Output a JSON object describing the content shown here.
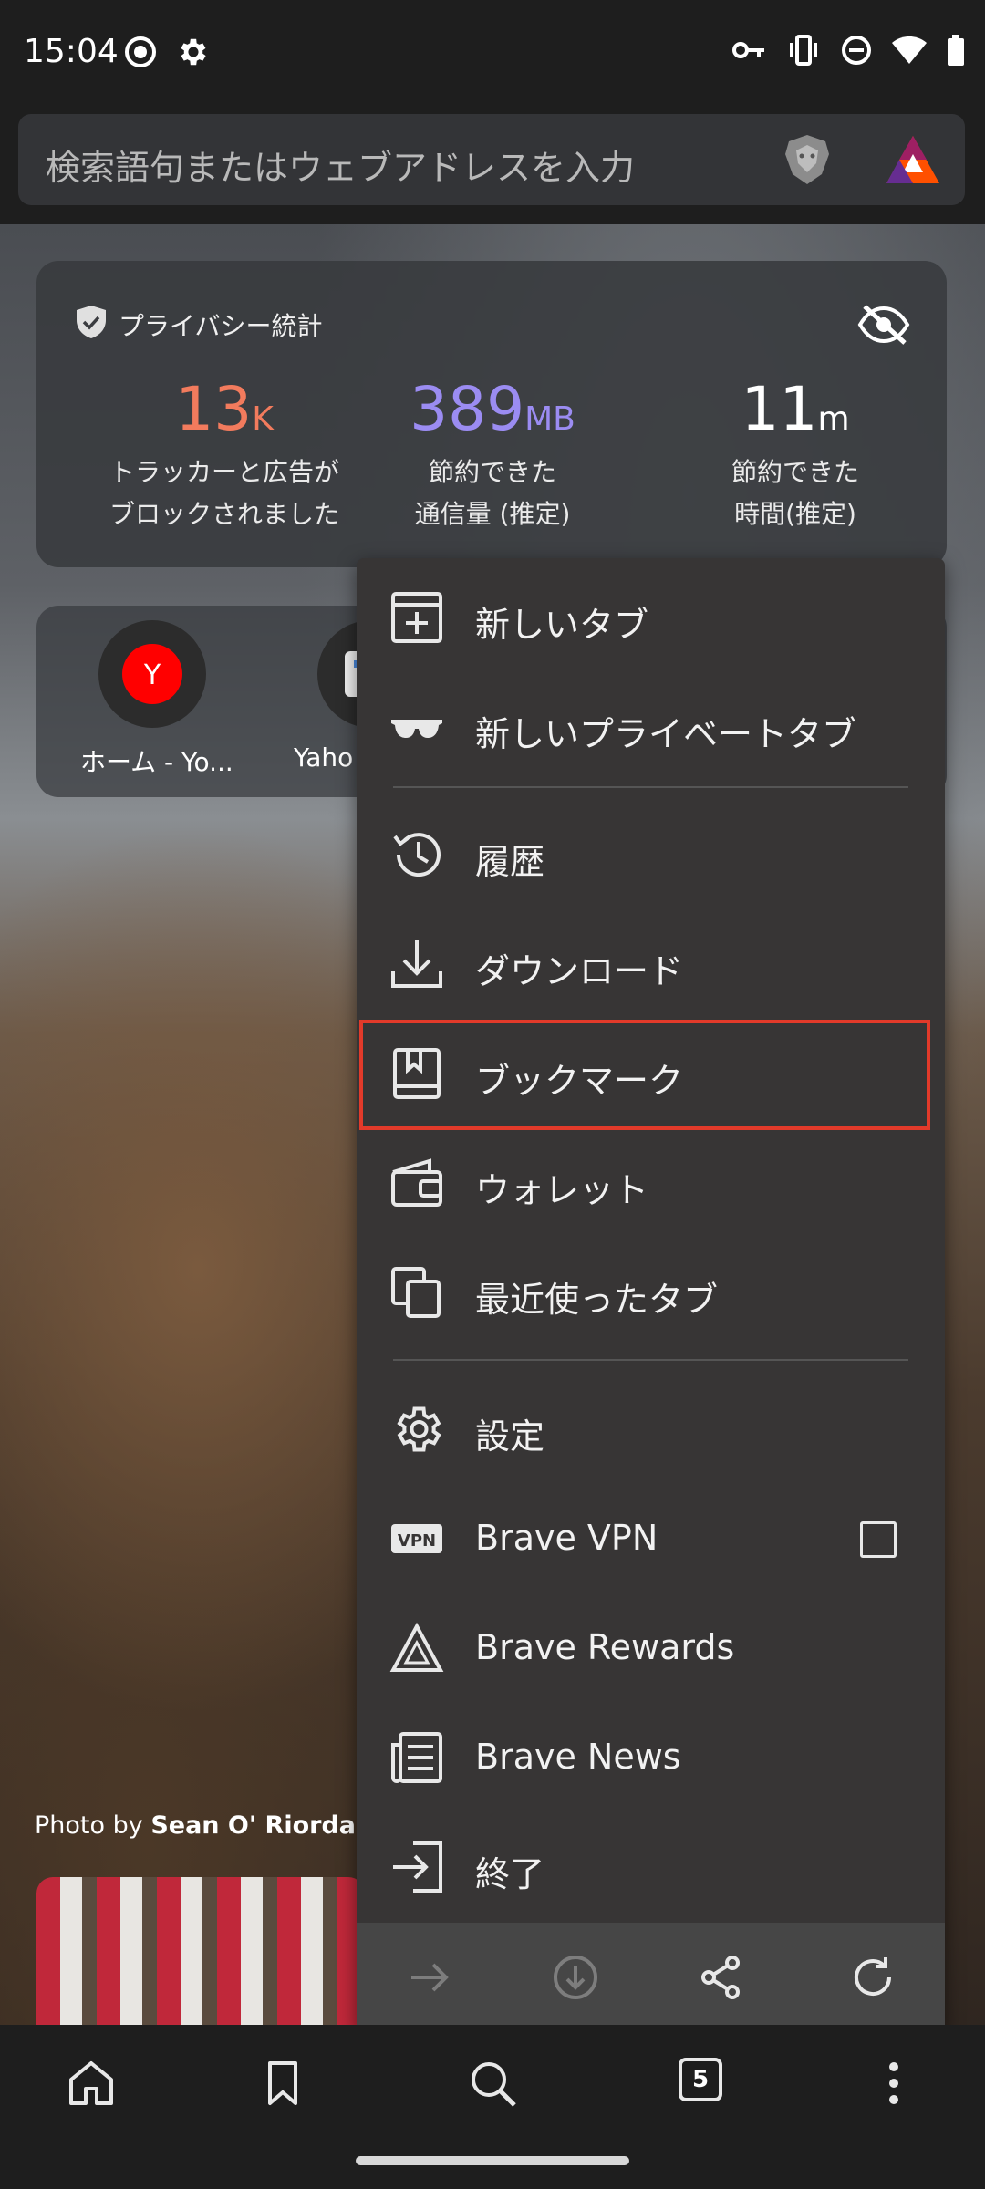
{
  "status_bar": {
    "time": "15:04"
  },
  "address_bar": {
    "placeholder": "検索語句またはウェブアドレスを入力"
  },
  "privacy_stats": {
    "title": "プライバシー統計",
    "trackers": {
      "value": "13",
      "unit": "K",
      "label_line1": "トラッカーと広告が",
      "label_line2": "ブロックされました",
      "color": "#f27b5d"
    },
    "bandwidth": {
      "value": "389",
      "unit": "MB",
      "label_line1": "節約できた",
      "label_line2": "通信量 (推定)",
      "color": "#9b8cf2"
    },
    "time": {
      "value": "11",
      "unit": "m",
      "label_line1": "節約できた",
      "label_line2": "時間(推定)",
      "color": "#ffffff"
    }
  },
  "top_sites": [
    {
      "label": "ホーム - Yo...",
      "icon_letter": "Y"
    },
    {
      "label": "Yaho"
    }
  ],
  "photo_credit": {
    "prefix": "Photo by ",
    "author": "Sean O' Riordan"
  },
  "menu": {
    "items": [
      {
        "label": "新しいタブ",
        "icon": "new-tab-icon"
      },
      {
        "label": "新しいプライベートタブ",
        "icon": "private-tab-glasses-icon"
      },
      {
        "label": "履歴",
        "icon": "history-icon"
      },
      {
        "label": "ダウンロード",
        "icon": "download-icon"
      },
      {
        "label": "ブックマーク",
        "icon": "bookmark-book-icon",
        "highlighted": true
      },
      {
        "label": "ウォレット",
        "icon": "wallet-icon"
      },
      {
        "label": "最近使ったタブ",
        "icon": "recent-tabs-icon"
      },
      {
        "label": "設定",
        "icon": "gear-icon"
      },
      {
        "label": "Brave VPN",
        "icon": "vpn-icon",
        "checkbox": false
      },
      {
        "label": "Brave Rewards",
        "icon": "rewards-triangle-icon"
      },
      {
        "label": "Brave News",
        "icon": "news-icon"
      },
      {
        "label": "終了",
        "icon": "exit-icon"
      }
    ],
    "highlight_color": "#e23a2a"
  },
  "bottom_nav": {
    "tab_count": "5"
  }
}
